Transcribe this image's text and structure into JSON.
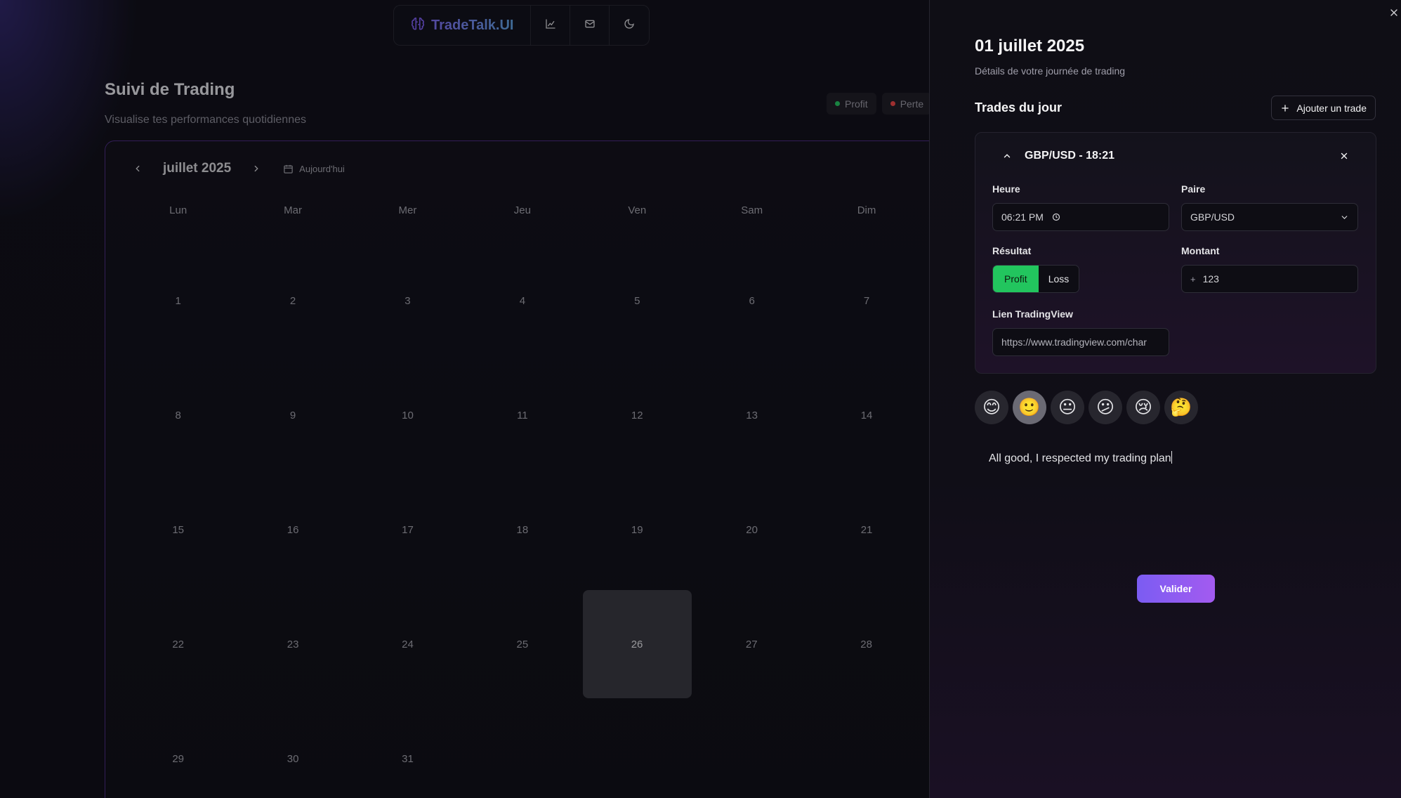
{
  "navbar": {
    "brand": "TradeTalk.UI",
    "icons": [
      "brain-icon",
      "chart-icon",
      "mail-icon",
      "moon-icon"
    ]
  },
  "page": {
    "title": "Suivi de Trading",
    "subtitle": "Visualise tes performances quotidiennes"
  },
  "legend": {
    "profit_label": "Profit",
    "loss_label": "Perte",
    "profit_color": "#22c55e",
    "loss_color": "#ef4444"
  },
  "calendar": {
    "month": "juillet 2025",
    "today_label": "Aujourd'hui",
    "weekdays": [
      "Lun",
      "Mar",
      "Mer",
      "Jeu",
      "Ven",
      "Sam",
      "Dim"
    ],
    "weeks": [
      [
        "1",
        "2",
        "3",
        "4",
        "5",
        "6",
        "7"
      ],
      [
        "8",
        "9",
        "10",
        "11",
        "12",
        "13",
        "14"
      ],
      [
        "15",
        "16",
        "17",
        "18",
        "19",
        "20",
        "21"
      ],
      [
        "22",
        "23",
        "24",
        "25",
        "26",
        "27",
        "28"
      ],
      [
        "29",
        "30",
        "31",
        "",
        "",
        "",
        ""
      ]
    ],
    "selected_day": "26"
  },
  "panel": {
    "title": "01 juillet 2025",
    "subtitle": "Détails de votre journée de trading",
    "trades_heading": "Trades du jour",
    "add_trade_label": "Ajouter un trade",
    "trade": {
      "header": "GBP/USD - 18:21",
      "time_label": "Heure",
      "time_value": "06:21 PM",
      "pair_label": "Paire",
      "pair_value": "GBP/USD",
      "result_label": "Résultat",
      "result_profit": "Profit",
      "result_loss": "Loss",
      "result_selected": "Profit",
      "amount_label": "Montant",
      "amount_sign": "+",
      "amount_value": "123",
      "link_label": "Lien TradingView",
      "link_value": "https://www.tradingview.com/char"
    },
    "moods": [
      "😊",
      "🙂",
      "😐",
      "😕",
      "😢",
      "🤔"
    ],
    "selected_mood_index": 1,
    "note": "All good, I respected my trading plan",
    "submit_label": "Valider"
  },
  "colors": {
    "accent": "#8b5cf6",
    "profit": "#22c55e"
  }
}
